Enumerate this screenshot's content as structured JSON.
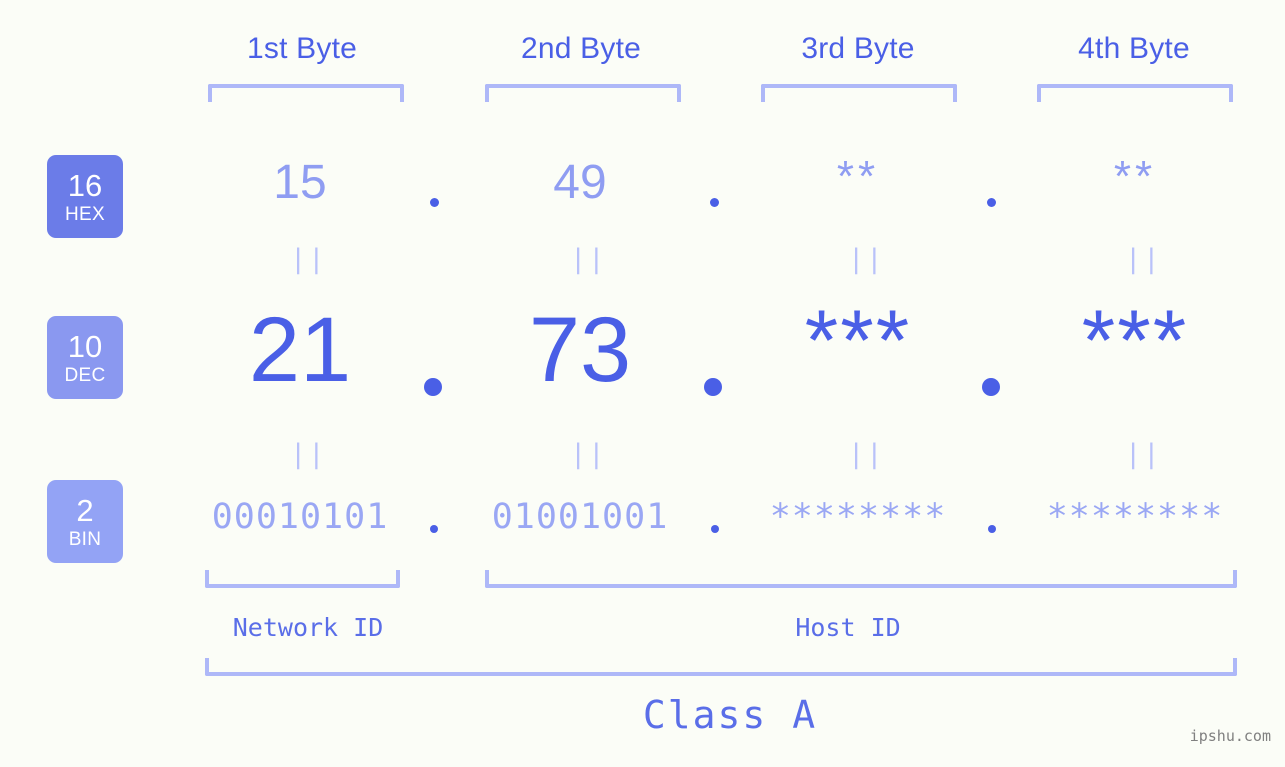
{
  "page": {
    "background_color": "#fbfdf7",
    "accent_color": "#4a5fe6",
    "muted_color": "#8f9df2",
    "bracket_color": "#aeb8f8",
    "watermark": "ipshu.com"
  },
  "byte_headers": [
    {
      "label": "1st Byte"
    },
    {
      "label": "2nd Byte"
    },
    {
      "label": "3rd Byte"
    },
    {
      "label": "4th Byte"
    }
  ],
  "bases": [
    {
      "number": "16",
      "name": "HEX",
      "color": "#6b7ce8"
    },
    {
      "number": "10",
      "name": "DEC",
      "color": "#8a98f0"
    },
    {
      "number": "2",
      "name": "BIN",
      "color": "#93a3f5"
    }
  ],
  "rows": {
    "hex": {
      "octets": [
        "15",
        "49",
        "**",
        "**"
      ],
      "separator": "."
    },
    "dec": {
      "octets": [
        "21",
        "73",
        "***",
        "***"
      ],
      "separator": "."
    },
    "bin": {
      "octets": [
        "00010101",
        "01001001",
        "********",
        "********"
      ],
      "separator": "."
    }
  },
  "equals_mark": "||",
  "sections": {
    "network_id": "Network ID",
    "host_id": "Host ID",
    "class": "Class A"
  }
}
